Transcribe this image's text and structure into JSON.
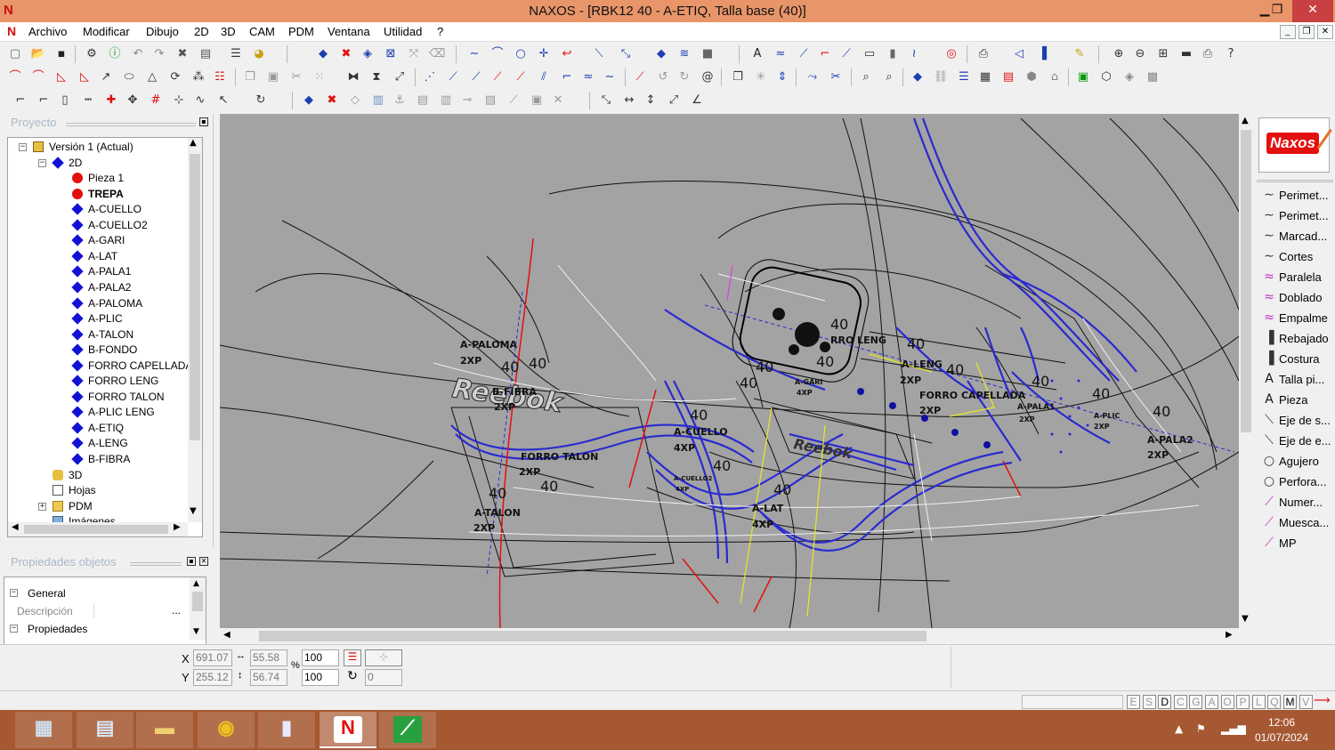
{
  "window": {
    "title": "NAXOS - [RBK12 40 - A-ETIQ, Talla base (40)]",
    "minimize": "▁",
    "restore": "❐",
    "close": "✕"
  },
  "menu": [
    "Archivo",
    "Modificar",
    "Dibujo",
    "2D",
    "3D",
    "CAM",
    "PDM",
    "Ventana",
    "Utilidad",
    "?"
  ],
  "project_panel": {
    "title": "Proyecto",
    "tree": [
      {
        "label": "Versión 1 (Actual)",
        "icon": "version-icon",
        "level": 0,
        "expander": "−"
      },
      {
        "label": "2D",
        "icon": "2d-icon",
        "level": 1,
        "expander": "−"
      },
      {
        "label": "Pieza 1",
        "icon": "red-dot-icon",
        "level": 2
      },
      {
        "label": "TREPA",
        "icon": "red-dot-icon",
        "level": 2,
        "bold": true
      },
      {
        "label": "A-CUELLO",
        "icon": "blue-diamond-icon",
        "level": 2
      },
      {
        "label": "A-CUELLO2",
        "icon": "blue-diamond-icon",
        "level": 2
      },
      {
        "label": "A-GARI",
        "icon": "blue-diamond-icon",
        "level": 2
      },
      {
        "label": "A-LAT",
        "icon": "blue-diamond-icon",
        "level": 2
      },
      {
        "label": "A-PALA1",
        "icon": "blue-diamond-icon",
        "level": 2
      },
      {
        "label": "A-PALA2",
        "icon": "blue-diamond-icon",
        "level": 2
      },
      {
        "label": "A-PALOMA",
        "icon": "blue-diamond-icon",
        "level": 2
      },
      {
        "label": "A-PLIC",
        "icon": "blue-diamond-icon",
        "level": 2
      },
      {
        "label": "A-TALON",
        "icon": "blue-diamond-icon",
        "level": 2
      },
      {
        "label": "B-FONDO",
        "icon": "blue-diamond-icon",
        "level": 2
      },
      {
        "label": "FORRO CAPELLADA",
        "icon": "blue-diamond-icon",
        "level": 2
      },
      {
        "label": "FORRO LENG",
        "icon": "blue-diamond-icon",
        "level": 2
      },
      {
        "label": "FORRO TALON",
        "icon": "blue-diamond-icon",
        "level": 2
      },
      {
        "label": "A-PLIC LENG",
        "icon": "blue-diamond-icon",
        "level": 2
      },
      {
        "label": "A-ETIQ",
        "icon": "blue-diamond-icon",
        "level": 2
      },
      {
        "label": "A-LENG",
        "icon": "blue-diamond-icon",
        "level": 2
      },
      {
        "label": "B-FIBRA",
        "icon": "blue-diamond-icon",
        "level": 2
      },
      {
        "label": "3D",
        "icon": "3d-icon",
        "level": 1
      },
      {
        "label": "Hojas",
        "icon": "sheets-icon",
        "level": 1
      },
      {
        "label": "PDM",
        "icon": "folder-icon",
        "level": 1,
        "expander": "+"
      },
      {
        "label": "Imágenes",
        "icon": "images-icon",
        "level": 1
      }
    ]
  },
  "properties_panel": {
    "title": "Propiedades objetos",
    "rows": [
      {
        "label": "General",
        "expander": "−"
      },
      {
        "label": "Descripción",
        "value": "",
        "button": "..."
      },
      {
        "label": "Propiedades",
        "expander": "−"
      }
    ]
  },
  "canvas": {
    "labels": [
      {
        "text": "A-PALOMA"
      },
      {
        "text": "2XP"
      },
      {
        "text": "40"
      },
      {
        "text": "40"
      },
      {
        "text": "Reebok"
      },
      {
        "text": "B-FIBRA"
      },
      {
        "text": "2XP"
      },
      {
        "text": "FORRO TALON"
      },
      {
        "text": "2XP"
      },
      {
        "text": "40"
      },
      {
        "text": "40"
      },
      {
        "text": "A-TALON"
      },
      {
        "text": "2XP"
      },
      {
        "text": "40"
      },
      {
        "text": "A-CUELLO"
      },
      {
        "text": "4XP"
      },
      {
        "text": "40"
      },
      {
        "text": "A-CUELLO2"
      },
      {
        "text": "4XP"
      },
      {
        "text": "40"
      },
      {
        "text": "A-LAT"
      },
      {
        "text": "4XP"
      },
      {
        "text": "40"
      },
      {
        "text": "RRO LENG"
      },
      {
        "text": "40"
      },
      {
        "text": "40"
      },
      {
        "text": "40"
      },
      {
        "text": "40"
      },
      {
        "text": "A-GARI"
      },
      {
        "text": "4XP"
      },
      {
        "text": "A-LENG"
      },
      {
        "text": "2XP"
      },
      {
        "text": "40"
      },
      {
        "text": "FORRO CAPELLADA"
      },
      {
        "text": "2XP"
      },
      {
        "text": "40"
      },
      {
        "text": "40"
      },
      {
        "text": "A-PALA1"
      },
      {
        "text": "2XP"
      },
      {
        "text": "A-PLIC"
      },
      {
        "text": "2XP"
      },
      {
        "text": "40"
      },
      {
        "text": "A-PALA2"
      },
      {
        "text": "2XP"
      },
      {
        "text": "Reebok"
      }
    ]
  },
  "right_panel": {
    "logo": "Naxos",
    "tools": [
      {
        "label": "Perimet...",
        "icon": "∼"
      },
      {
        "label": "Perimet...",
        "icon": "∼"
      },
      {
        "label": "Marcad...",
        "icon": "∼"
      },
      {
        "label": "Cortes",
        "icon": "∼"
      },
      {
        "label": "Paralela",
        "icon": "≈"
      },
      {
        "label": "Doblado",
        "icon": "≈"
      },
      {
        "label": "Empalme",
        "icon": "≈"
      },
      {
        "label": "Rebajado",
        "icon": "▐"
      },
      {
        "label": "Costura",
        "icon": "▐"
      },
      {
        "label": "Talla pi...",
        "icon": "A"
      },
      {
        "label": "Pieza",
        "icon": "A"
      },
      {
        "label": "Eje de s...",
        "icon": "⟍"
      },
      {
        "label": "Eje de e...",
        "icon": "⟍"
      },
      {
        "label": "Agujero",
        "icon": "○"
      },
      {
        "label": "Perfora...",
        "icon": "○"
      },
      {
        "label": "Numer...",
        "icon": "⟋"
      },
      {
        "label": "Muesca...",
        "icon": "⟋"
      },
      {
        "label": "MP",
        "icon": "⟋"
      }
    ]
  },
  "coords": {
    "x_label": "X",
    "y_label": "Y",
    "x": "691.07",
    "y": "255.12",
    "dx": "55.58",
    "dy": "56.74",
    "scale_x": "100",
    "scale_y": "100",
    "percent": "%",
    "angle": "0"
  },
  "status_keys": [
    "E",
    "S",
    "D",
    "C",
    "G",
    "A",
    "O",
    "P",
    "L",
    "Q",
    "M",
    "V"
  ],
  "status_keys_on": [
    "D",
    "M"
  ],
  "taskbar": {
    "time": "12:06",
    "date": "01/07/2024"
  },
  "colors": {
    "titlebar": "#e9956a",
    "canvas": "#a3a3a3",
    "taskbar": "#a65832",
    "accent_blue": "#2a2ad0",
    "accent_red": "#e31010"
  }
}
